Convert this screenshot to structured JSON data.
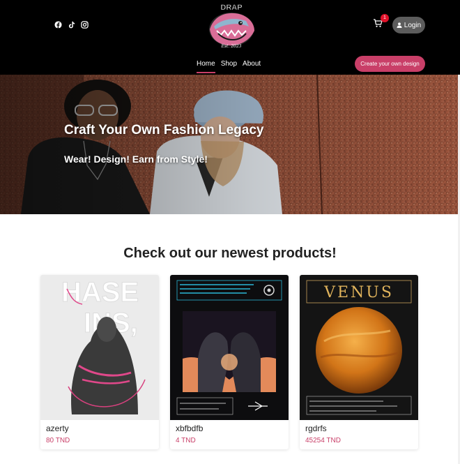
{
  "header": {
    "socials": [
      "facebook-icon",
      "tiktok-icon",
      "instagram-icon"
    ],
    "logo": {
      "brand_text": "DRAP",
      "est_text": "Est. 2023"
    },
    "cart_count": "1",
    "login_label": "Login",
    "nav": [
      {
        "label": "Home",
        "active": true
      },
      {
        "label": "Shop",
        "active": false
      },
      {
        "label": "About",
        "active": false
      }
    ],
    "create_label": "Create your own design"
  },
  "hero": {
    "title": "Craft Your Own Fashion Legacy",
    "subtitle": "Wear! Design! Earn from Style!"
  },
  "products": {
    "section_title": "Check out our newest products!",
    "items": [
      {
        "name": "azerty",
        "price": "80 TND"
      },
      {
        "name": "xbfbdfb",
        "price": "4 TND"
      },
      {
        "name": "rgdrfs",
        "price": "45254 TND"
      }
    ]
  },
  "colors": {
    "header_bg": "#000000",
    "accent": "#c93f68",
    "login_bg": "#5c5c5c",
    "badge": "#e0122a"
  }
}
